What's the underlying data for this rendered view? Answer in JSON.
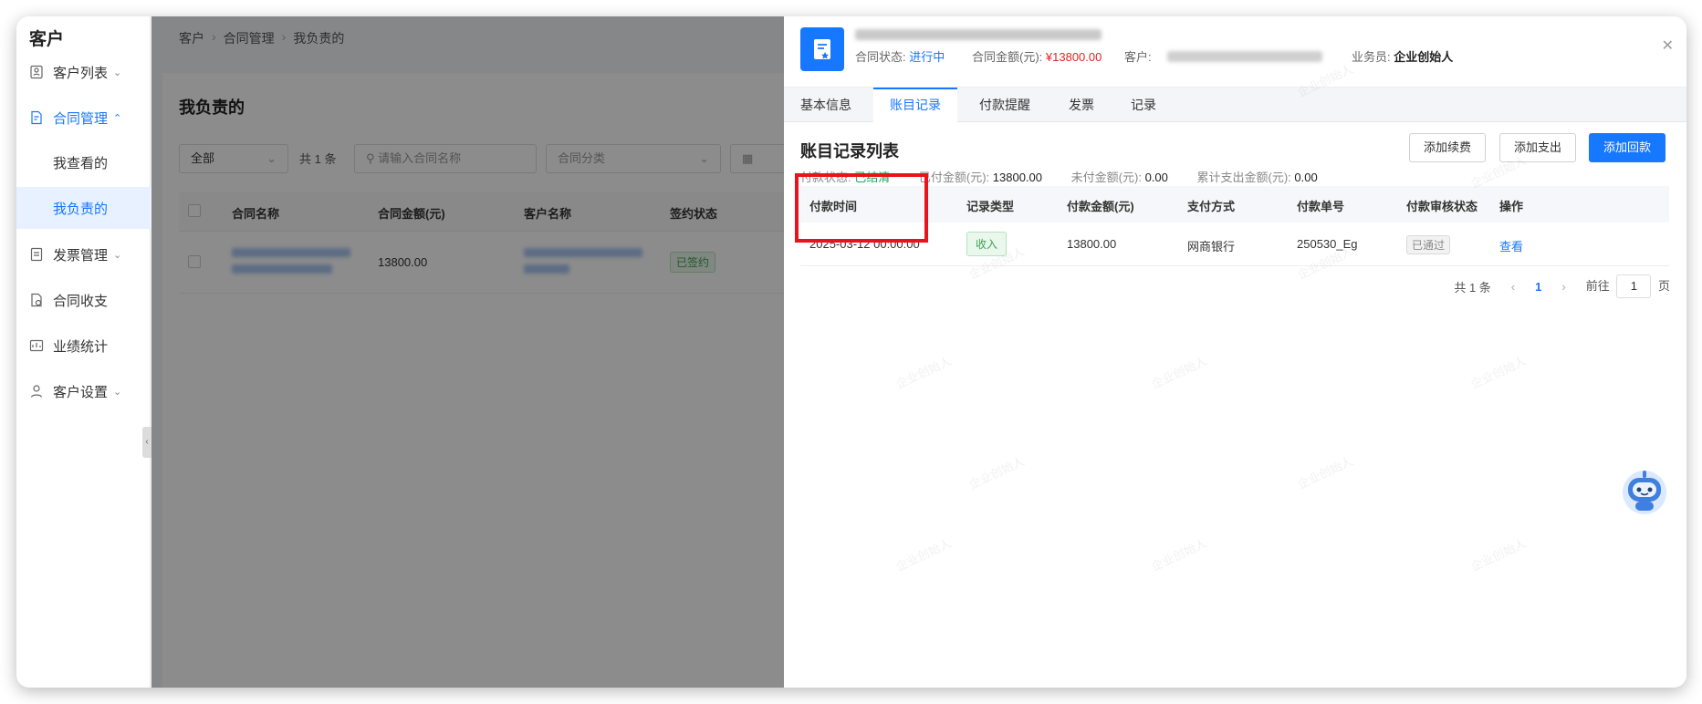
{
  "sidebar": {
    "app_title": "客户",
    "items": [
      {
        "label": "客户列表",
        "icon": "customer-list-icon"
      },
      {
        "label": "合同管理",
        "icon": "contract-icon"
      },
      {
        "label": "发票管理",
        "icon": "invoice-icon"
      },
      {
        "label": "合同收支",
        "icon": "contract-finance-icon"
      },
      {
        "label": "业绩统计",
        "icon": "stats-icon"
      },
      {
        "label": "客户设置",
        "icon": "customer-settings-icon"
      }
    ],
    "sub_items": [
      {
        "label": "我查看的"
      },
      {
        "label": "我负责的"
      }
    ]
  },
  "breadcrumb": [
    "客户",
    "合同管理",
    "我负责的"
  ],
  "main": {
    "page_title": "我负责的",
    "filter_all": "全部",
    "count_text": "共 1 条",
    "search_placeholder": "请输入合同名称",
    "category_placeholder": "合同分类",
    "columns": [
      "合同名称",
      "合同金额(元)",
      "客户名称",
      "签约状态"
    ],
    "row": {
      "amount": "13800.00",
      "status": "已签约"
    }
  },
  "drawer": {
    "meta": {
      "status_label": "合同状态:",
      "status_value": "进行中",
      "amount_label": "合同金额(元):",
      "amount_value": "¥13800.00",
      "customer_label": "客户:",
      "salesperson_label": "业务员:",
      "salesperson_value": "企业创始人"
    },
    "tabs": [
      "基本信息",
      "账目记录",
      "付款提醒",
      "发票",
      "记录"
    ],
    "section_title": "账目记录列表",
    "buttons": {
      "renew": "添加续费",
      "expense": "添加支出",
      "payment": "添加回款"
    },
    "summary": {
      "pay_status_label": "付款状态:",
      "pay_status_value": "已结清",
      "paid_label": "已付金额(元):",
      "paid_value": "13800.00",
      "unpaid_label": "未付金额(元):",
      "unpaid_value": "0.00",
      "expense_label": "累计支出金额(元):",
      "expense_value": "0.00"
    },
    "columns": [
      "付款时间",
      "记录类型",
      "付款金额(元)",
      "支付方式",
      "付款单号",
      "付款审核状态",
      "操作"
    ],
    "rows": [
      {
        "time": "2025-03-12 00:00:00",
        "type": "收入",
        "amount": "13800.00",
        "method": "网商银行",
        "number": "250530_Eg",
        "audit": "已通过",
        "action": "查看"
      }
    ],
    "pagination": {
      "total": "共 1 条",
      "current": "1",
      "goto_label": "前往",
      "goto_value": "1",
      "page_unit": "页"
    },
    "watermark": "企业创始人"
  },
  "colors": {
    "accent": "#1677ff",
    "danger": "#e02424",
    "success": "#1aaa55",
    "highlight": "#e8141b"
  }
}
